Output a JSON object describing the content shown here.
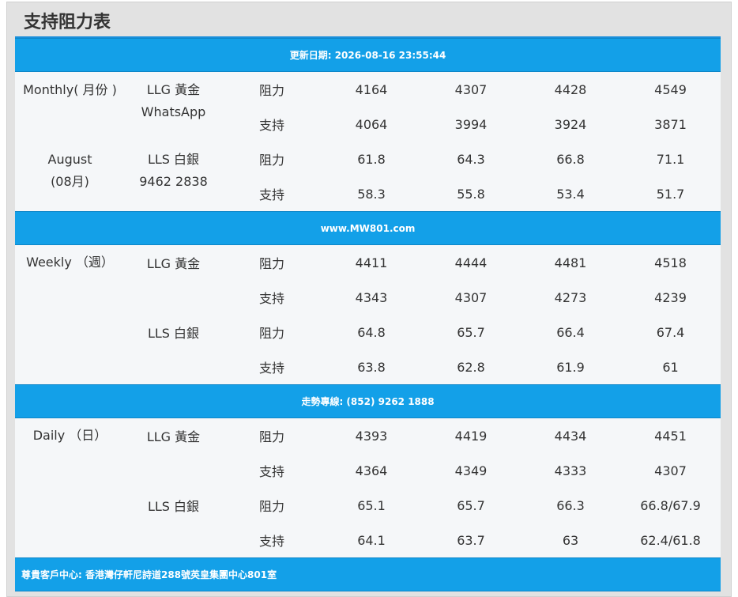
{
  "page_title": "支持阻力表",
  "header_bar": "更新日期: 2026-08-16 23:55:44",
  "website_bar": "www.MW801.com",
  "hotline_bar": "走勢專線: (852) 9262 1888",
  "footer_bar": "尊貴客戶中心: 香港灣仔軒尼詩道288號英皇集團中心801室",
  "monthly": {
    "period_label": "Monthly( 月份 )",
    "month_en": "August",
    "month_zh": "(08月)",
    "llg_label": "LLG 黃金",
    "whatsapp_label": "WhatsApp",
    "lls_label": "LLS 白銀",
    "phone": "9462 2838",
    "rows": [
      {
        "type": "阻力",
        "values": [
          "4164",
          "4307",
          "4428",
          "4549"
        ]
      },
      {
        "type": "支持",
        "values": [
          "4064",
          "3994",
          "3924",
          "3871"
        ]
      },
      {
        "type": "阻力",
        "values": [
          "61.8",
          "64.3",
          "66.8",
          "71.1"
        ]
      },
      {
        "type": "支持",
        "values": [
          "58.3",
          "55.8",
          "53.4",
          "51.7"
        ]
      }
    ]
  },
  "weekly": {
    "period_label": "Weekly （週）",
    "llg_label": "LLG 黃金",
    "lls_label": "LLS 白銀",
    "rows": [
      {
        "type": "阻力",
        "values": [
          "4411",
          "4444",
          "4481",
          "4518"
        ]
      },
      {
        "type": "支持",
        "values": [
          "4343",
          "4307",
          "4273",
          "4239"
        ]
      },
      {
        "type": "阻力",
        "values": [
          "64.8",
          "65.7",
          "66.4",
          "67.4"
        ]
      },
      {
        "type": "支持",
        "values": [
          "63.8",
          "62.8",
          "61.9",
          "61"
        ]
      }
    ]
  },
  "daily": {
    "period_label": "Daily （日）",
    "llg_label": "LLG 黃金",
    "lls_label": "LLS 白銀",
    "rows": [
      {
        "type": "阻力",
        "values": [
          "4393",
          "4419",
          "4434",
          "4451"
        ]
      },
      {
        "type": "支持",
        "values": [
          "4364",
          "4349",
          "4333",
          "4307"
        ]
      },
      {
        "type": "阻力",
        "values": [
          "65.1",
          "65.7",
          "66.3",
          "66.8/67.9"
        ]
      },
      {
        "type": "支持",
        "values": [
          "64.1",
          "63.7",
          "63",
          "62.4/61.8"
        ]
      }
    ]
  },
  "highlight_color": "#f7f3a8",
  "header_color": "#13a0e8"
}
